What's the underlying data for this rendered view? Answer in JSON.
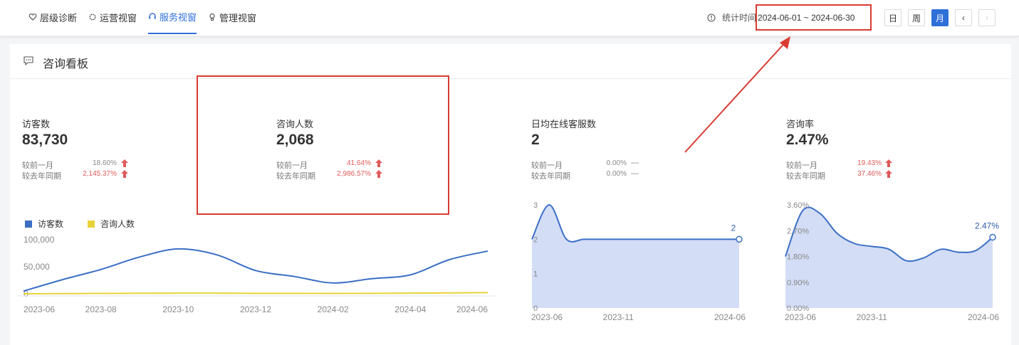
{
  "tabs": [
    {
      "label": "层级诊断",
      "icon": "heart-icon"
    },
    {
      "label": "运营视窗",
      "icon": "gear-icon"
    },
    {
      "label": "服务视窗",
      "icon": "headset-icon"
    },
    {
      "label": "管理视窗",
      "icon": "lightbulb-icon"
    }
  ],
  "header": {
    "stat_label": "统计时间",
    "date_range": "2024-06-01 ~ 2024-06-30",
    "buttons": [
      "日",
      "周",
      "月"
    ],
    "prev": "‹",
    "next": "›"
  },
  "panel": {
    "title": "咨询看板"
  },
  "metrics": [
    {
      "label": "访客数",
      "value": "83,730",
      "mom_label": "较前一月",
      "mom": "18.60%",
      "yoy_label": "较去年同期",
      "yoy": "2,145.37%"
    },
    {
      "label": "咨询人数",
      "value": "2,068",
      "mom_label": "较前一月",
      "mom": "41.64%",
      "yoy_label": "较去年同期",
      "yoy": "2,986.57%"
    },
    {
      "label": "日均在线客服数",
      "value": "2",
      "mom_label": "较前一月",
      "mom": "0.00%",
      "mom_trend": "—",
      "yoy_label": "较去年同期",
      "yoy": "0.00%",
      "yoy_trend": "—"
    },
    {
      "label": "咨询率",
      "value": "2.47%",
      "mom_label": "较前一月",
      "mom": "19.43%",
      "yoy_label": "较去年同期",
      "yoy": "37.46%"
    }
  ],
  "chart_data": [
    {
      "type": "line",
      "series": [
        {
          "name": "访客数",
          "color": "#3b6fc6",
          "x": [
            "2023-06",
            "2023-07",
            "2023-08",
            "2023-09",
            "2023-10",
            "2023-11",
            "2023-12",
            "2024-01",
            "2024-02",
            "2024-03",
            "2024-04",
            "2024-05",
            "2024-06"
          ],
          "values": [
            5000,
            26000,
            45000,
            68000,
            83000,
            72000,
            43000,
            32000,
            20000,
            28000,
            35000,
            63000,
            79000
          ]
        },
        {
          "name": "咨询人数",
          "color": "#e8d23a",
          "x": [
            "2023-06",
            "2023-07",
            "2023-08",
            "2023-09",
            "2023-10",
            "2023-11",
            "2023-12",
            "2024-01",
            "2024-02",
            "2024-03",
            "2024-04",
            "2024-05",
            "2024-06"
          ],
          "values": [
            60,
            300,
            700,
            1000,
            1200,
            1100,
            900,
            800,
            700,
            900,
            1200,
            1600,
            2068
          ]
        }
      ],
      "xticks": [
        "2023-06",
        "2023-08",
        "2023-10",
        "2023-12",
        "2024-02",
        "2024-04",
        "2024-06"
      ],
      "yticks": [
        "0",
        "50,000",
        "100,000"
      ],
      "ylim": [
        0,
        100000
      ],
      "legend": "top-left",
      "grid": false
    },
    {
      "type": "area",
      "x": [
        "2023-06",
        "2023-07",
        "2023-08",
        "2023-09",
        "2023-10",
        "2023-11",
        "2023-12",
        "2024-01",
        "2024-02",
        "2024-03",
        "2024-04",
        "2024-05",
        "2024-06"
      ],
      "values": [
        2,
        3,
        2,
        2,
        2,
        2,
        2,
        2,
        2,
        2,
        2,
        2,
        2
      ],
      "yticks": [
        "0",
        "1",
        "2",
        "3"
      ],
      "ylim": [
        0,
        3
      ],
      "xticks": [
        "2023-06",
        "2023-11",
        "2024-06"
      ],
      "end_label": "2",
      "color": "#3b6fc6"
    },
    {
      "type": "area",
      "x": [
        "2023-06",
        "2023-07",
        "2023-08",
        "2023-09",
        "2023-10",
        "2023-11",
        "2023-12",
        "2024-01",
        "2024-02",
        "2024-03",
        "2024-04",
        "2024-05",
        "2024-06"
      ],
      "values": [
        1.8,
        3.4,
        3.3,
        2.6,
        2.25,
        2.15,
        2.05,
        1.65,
        1.75,
        2.05,
        1.95,
        2.0,
        2.47
      ],
      "yticks": [
        "0.00%",
        "0.90%",
        "1.80%",
        "2.70%",
        "3.60%"
      ],
      "ylim": [
        0,
        3.6
      ],
      "xticks": [
        "2023-06",
        "2023-11",
        "2024-06"
      ],
      "end_label": "2.47%",
      "color": "#3b6fc6"
    }
  ]
}
